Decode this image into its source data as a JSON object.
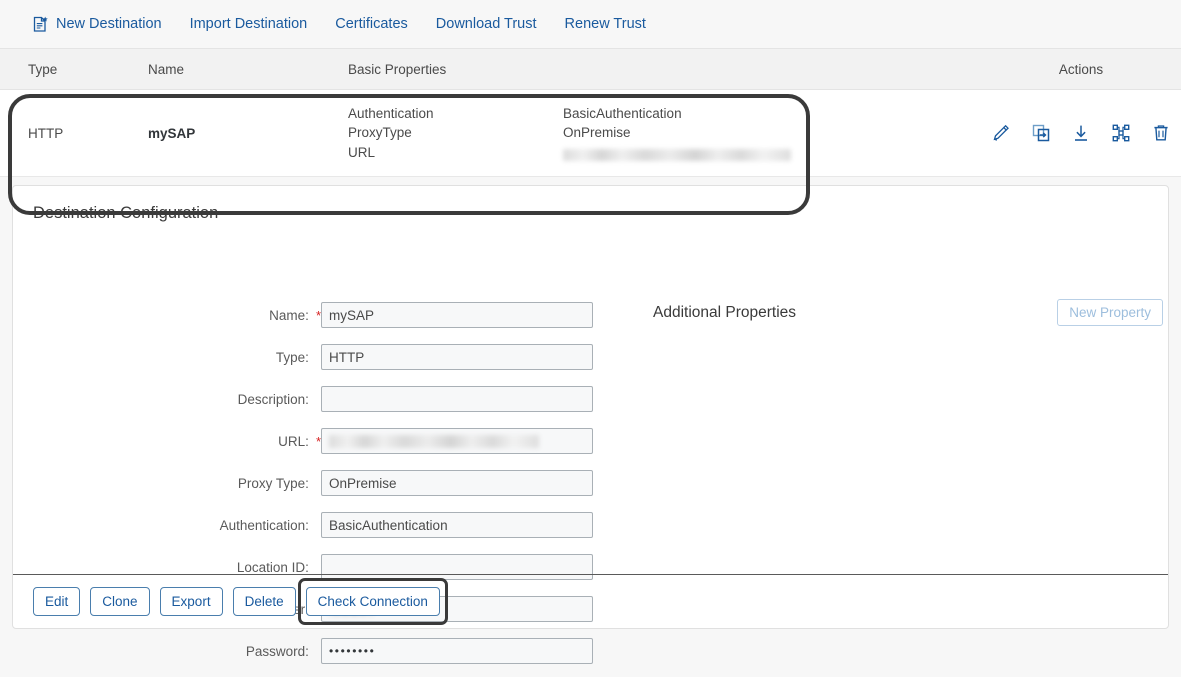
{
  "toolbar": {
    "items": [
      {
        "label": "New Destination",
        "icon": "new-document-icon"
      },
      {
        "label": "Import Destination",
        "icon": "none"
      },
      {
        "label": "Certificates",
        "icon": "none"
      },
      {
        "label": "Download Trust",
        "icon": "none"
      },
      {
        "label": "Renew Trust",
        "icon": "none"
      }
    ]
  },
  "table": {
    "headers": {
      "type": "Type",
      "name": "Name",
      "basic_properties": "Basic Properties",
      "values": "",
      "actions": "Actions"
    },
    "rows": [
      {
        "type": "HTTP",
        "name": "mySAP",
        "properties": [
          "Authentication",
          "ProxyType",
          "URL"
        ],
        "values": [
          "BasicAuthentication",
          "OnPremise",
          "[redacted]"
        ],
        "actions": [
          {
            "name": "edit-icon",
            "title": "Edit"
          },
          {
            "name": "clone-icon",
            "title": "Clone"
          },
          {
            "name": "download-icon",
            "title": "Export"
          },
          {
            "name": "check-connection-icon",
            "title": "Check Connection"
          },
          {
            "name": "delete-icon",
            "title": "Delete"
          }
        ]
      }
    ]
  },
  "card": {
    "title": "Destination Configuration",
    "fields": [
      {
        "label": "Name:",
        "required": true,
        "value": "mySAP",
        "redacted": false,
        "password": false
      },
      {
        "label": "Type:",
        "required": false,
        "value": "HTTP",
        "redacted": false,
        "password": false
      },
      {
        "label": "Description:",
        "required": false,
        "value": "",
        "redacted": false,
        "password": false
      },
      {
        "label": "URL:",
        "required": true,
        "value": "[redacted]",
        "redacted": true,
        "password": false
      },
      {
        "label": "Proxy Type:",
        "required": false,
        "value": "OnPremise",
        "redacted": false,
        "password": false
      },
      {
        "label": "Authentication:",
        "required": false,
        "value": "BasicAuthentication",
        "redacted": false,
        "password": false
      },
      {
        "label": "Location ID:",
        "required": false,
        "value": "",
        "redacted": false,
        "password": false
      },
      {
        "label": "User:",
        "required": true,
        "value": "[redacted]",
        "redacted": true,
        "password": false
      },
      {
        "label": "Password:",
        "required": false,
        "value": "••••••••",
        "redacted": false,
        "password": true
      }
    ],
    "additional_properties": {
      "title": "Additional Properties",
      "new_property_label": "New Property",
      "new_property_enabled": false
    },
    "footer_buttons": [
      {
        "label": "Edit",
        "highlighted": false
      },
      {
        "label": "Clone",
        "highlighted": false
      },
      {
        "label": "Export",
        "highlighted": false
      },
      {
        "label": "Delete",
        "highlighted": false
      },
      {
        "label": "Check Connection",
        "highlighted": true
      }
    ]
  },
  "annotations": {
    "row_highlight": "table-row-mySAP",
    "button_highlight": "Check Connection",
    "color": "#3a3a3a"
  },
  "colors": {
    "link": "#1a5a9e",
    "required": "#d62323",
    "page_bg": "#f7f7f7",
    "card_bg": "#ffffff",
    "header_bg": "#f2f2f2"
  }
}
